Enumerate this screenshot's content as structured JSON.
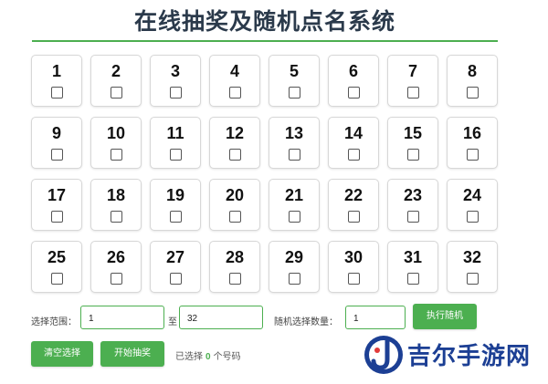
{
  "title": "在线抽奖及随机点名系统",
  "numbers": [
    "1",
    "2",
    "3",
    "4",
    "5",
    "6",
    "7",
    "8",
    "9",
    "10",
    "11",
    "12",
    "13",
    "14",
    "15",
    "16",
    "17",
    "18",
    "19",
    "20",
    "21",
    "22",
    "23",
    "24",
    "25",
    "26",
    "27",
    "28",
    "29",
    "30",
    "31",
    "32"
  ],
  "controls": {
    "range_label": "选择范围：",
    "range_start": "1",
    "to_label": "至",
    "range_end": "32",
    "random_count_label": "随机选择数量：",
    "random_count": "1",
    "execute_button": "执行随机"
  },
  "actions": {
    "clear_button": "清空选择",
    "start_button": "开始抽奖"
  },
  "status": {
    "prefix": "已选择",
    "count": "0",
    "suffix": "个号码"
  },
  "watermark": {
    "text": "吉尔手游网"
  },
  "colors": {
    "accent": "#4caf50",
    "title": "#2b3a4b",
    "watermark": "#1c3f94"
  }
}
